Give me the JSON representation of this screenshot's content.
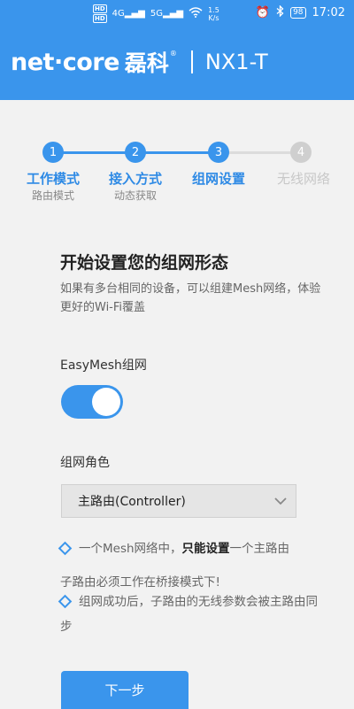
{
  "status_bar": {
    "hd1": "HD",
    "hd2": "HD",
    "sig1": "4G",
    "sig2": "5G",
    "speed_value": "1.5",
    "speed_unit": "K/s",
    "battery": "98",
    "time": "17:02"
  },
  "header": {
    "brand": "net·core",
    "brand_cn": "磊科",
    "reg": "®",
    "model": "NX1-T"
  },
  "steps": [
    {
      "num": "1",
      "name": "工作模式",
      "sub": "路由模式"
    },
    {
      "num": "2",
      "name": "接入方式",
      "sub": "动态获取"
    },
    {
      "num": "3",
      "name": "组网设置",
      "sub": ""
    },
    {
      "num": "4",
      "name": "无线网络",
      "sub": ""
    }
  ],
  "main": {
    "title": "开始设置您的组网形态",
    "desc": "如果有多台相同的设备，可以组建Mesh网络，体验更好的Wi-Fi覆盖",
    "easymesh_label": "EasyMesh组网",
    "easymesh_on": true,
    "role_label": "组网角色",
    "role_value": "主路由(Controller)",
    "note1_a": "一个Mesh网络中，",
    "note1_b": "只能设置",
    "note1_c": "一个主路由",
    "note2": "子路由必须工作在桥接模式下!",
    "note3": "组网成功后，子路由的无线参数会被主路由同步",
    "next_button": "下一步"
  },
  "colors": {
    "accent": "#3a95ec",
    "inactive": "#cfcfcf"
  }
}
